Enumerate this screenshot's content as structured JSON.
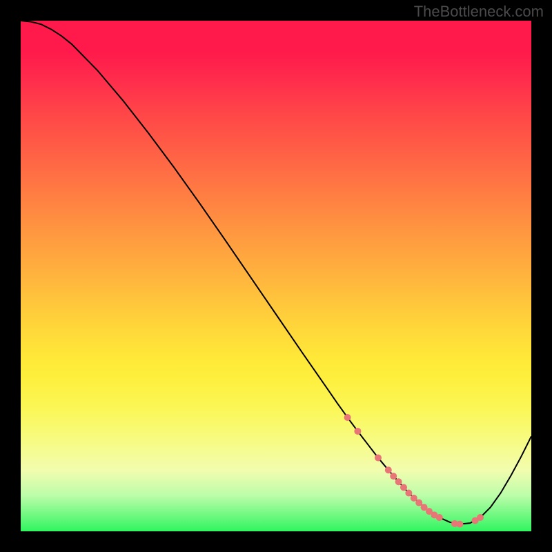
{
  "watermark": "TheBottleneck.com",
  "colors": {
    "bg": "#000000",
    "gradient_top": "#ff1a4b",
    "gradient_bottom": "#30f560",
    "curve": "#000000",
    "dots": "#e97676",
    "watermark": "#4a4a4a"
  },
  "chart_data": {
    "type": "line",
    "title": "",
    "xlabel": "",
    "ylabel": "",
    "xlim": [
      0,
      100
    ],
    "ylim": [
      0,
      100
    ],
    "legend": [],
    "grid": false,
    "annotations": [],
    "series": [
      {
        "name": "curve",
        "x": [
          0,
          2,
          4,
          6,
          8,
          10,
          15,
          20,
          25,
          30,
          35,
          40,
          45,
          50,
          55,
          60,
          62,
          64,
          66,
          68,
          70,
          72,
          74,
          76,
          78,
          80,
          82,
          84,
          86,
          88,
          90,
          92,
          94,
          96,
          98,
          100
        ],
        "values": [
          100.0,
          99.8,
          99.3,
          98.3,
          97.0,
          95.4,
          90.3,
          84.4,
          78.0,
          71.3,
          64.3,
          57.1,
          49.8,
          42.5,
          35.2,
          28.0,
          25.1,
          22.3,
          19.6,
          17.0,
          14.4,
          12.0,
          9.7,
          7.5,
          5.6,
          3.9,
          2.7,
          1.8,
          1.4,
          1.6,
          2.7,
          4.7,
          7.5,
          10.9,
          14.6,
          18.6
        ]
      }
    ],
    "dots": {
      "x": [
        64,
        66,
        70,
        72,
        73,
        74,
        75,
        76,
        77,
        78,
        79,
        80,
        81,
        82,
        85,
        86,
        89,
        90
      ],
      "values": [
        22.3,
        19.6,
        14.4,
        12.0,
        10.8,
        9.7,
        8.6,
        7.5,
        6.5,
        5.6,
        4.7,
        3.9,
        3.2,
        2.7,
        1.5,
        1.4,
        2.1,
        2.7
      ]
    }
  }
}
